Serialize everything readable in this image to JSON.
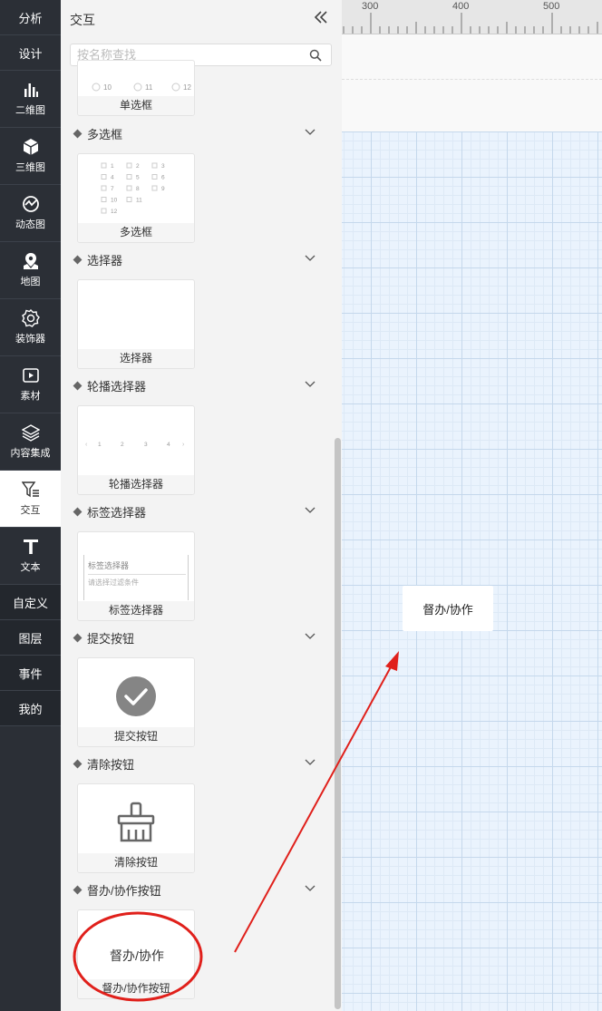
{
  "nav": {
    "top_items": [
      "分析",
      "设计"
    ],
    "icon_items": [
      {
        "label": "二维图",
        "icon": "bar-chart-icon"
      },
      {
        "label": "三维图",
        "icon": "cube-icon"
      },
      {
        "label": "动态图",
        "icon": "dynamic-chart-icon"
      },
      {
        "label": "地图",
        "icon": "map-pin-icon"
      },
      {
        "label": "装饰器",
        "icon": "decorator-icon"
      },
      {
        "label": "素材",
        "icon": "play-square-icon"
      },
      {
        "label": "内容集成",
        "icon": "layers-icon"
      },
      {
        "label": "交互",
        "icon": "filter-icon",
        "active": true
      },
      {
        "label": "文本",
        "icon": "text-t-icon"
      }
    ],
    "bottom_items": [
      "自定义",
      "图层",
      "事件",
      "我的"
    ]
  },
  "panel": {
    "title": "交互",
    "search_placeholder": "按名称查找",
    "first_card": {
      "label": "单选框",
      "preview_options": [
        "10",
        "11",
        "12"
      ]
    },
    "sections": [
      {
        "title": "多选框",
        "card_label": "多选框",
        "preview": {
          "items": [
            "1",
            "2",
            "3",
            "4",
            "5",
            "6",
            "7",
            "8",
            "9",
            "10",
            "11",
            "12"
          ]
        }
      },
      {
        "title": "选择器",
        "card_label": "选择器"
      },
      {
        "title": "轮播选择器",
        "card_label": "轮播选择器",
        "preview": {
          "items": [
            "1",
            "2",
            "3",
            "4"
          ]
        }
      },
      {
        "title": "标签选择器",
        "card_label": "标签选择器",
        "preview": {
          "title": "标签选择器",
          "placeholder": "请选择过滤条件"
        }
      },
      {
        "title": "提交按钮",
        "card_label": "提交按钮"
      },
      {
        "title": "清除按钮",
        "card_label": "清除按钮"
      },
      {
        "title": "督办/协作按钮",
        "card_label": "督办/协作按钮",
        "preview": {
          "text": "督办/协作"
        }
      }
    ]
  },
  "canvas": {
    "ruler_labels": [
      "300",
      "400",
      "500"
    ],
    "placed_widget_text": "督办/协作"
  },
  "colors": {
    "nav_bg": "#2b2f36",
    "annotation_red": "#e0201b",
    "canvas_bg": "#eaf3fd"
  }
}
